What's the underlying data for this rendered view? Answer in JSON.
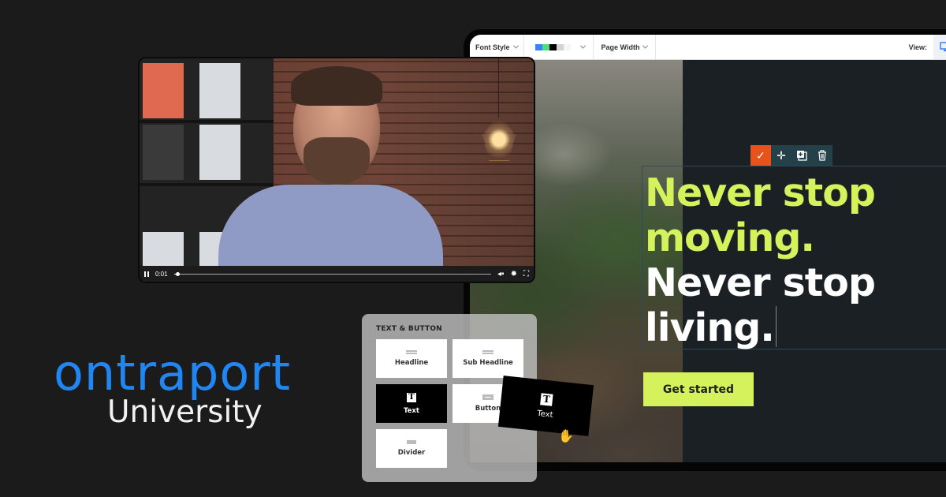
{
  "brand": {
    "logo_text": "ontraport",
    "sub_text": "University",
    "logo_color": "#1f86f2"
  },
  "video_player": {
    "time": "0:01",
    "progress_fraction": 0.01,
    "icons": [
      "pause-icon",
      "volume-icon",
      "settings-icon",
      "fullscreen-icon"
    ]
  },
  "editor": {
    "toolbar": {
      "font_style_label": "Font Style",
      "color_swatches": [
        "#3b82f6",
        "#4ade80",
        "#000000",
        "#d4d4d4",
        "#f5f5f5"
      ],
      "page_width_label": "Page Width",
      "view_label": "View:"
    },
    "selection_toolbar": {
      "icons": [
        "check-icon",
        "move-icon",
        "duplicate-icon",
        "trash-icon"
      ],
      "accent_color": "#e8531c"
    },
    "headline": {
      "line1": "Never stop moving.",
      "line2": "Never stop living.",
      "highlight_color": "#d5f25c"
    },
    "cta_label": "Get started"
  },
  "elements_panel": {
    "title": "TEXT & BUTTON",
    "tiles": [
      {
        "label": "Headline",
        "icon": "headline-icon"
      },
      {
        "label": "Sub Headline",
        "icon": "sub-headline-icon"
      },
      {
        "label": "Text",
        "icon": "text-icon",
        "selected": true
      },
      {
        "label": "Button",
        "icon": "button-icon"
      },
      {
        "label": "Divider",
        "icon": "divider-icon"
      }
    ],
    "dragging": {
      "label": "Text"
    }
  }
}
